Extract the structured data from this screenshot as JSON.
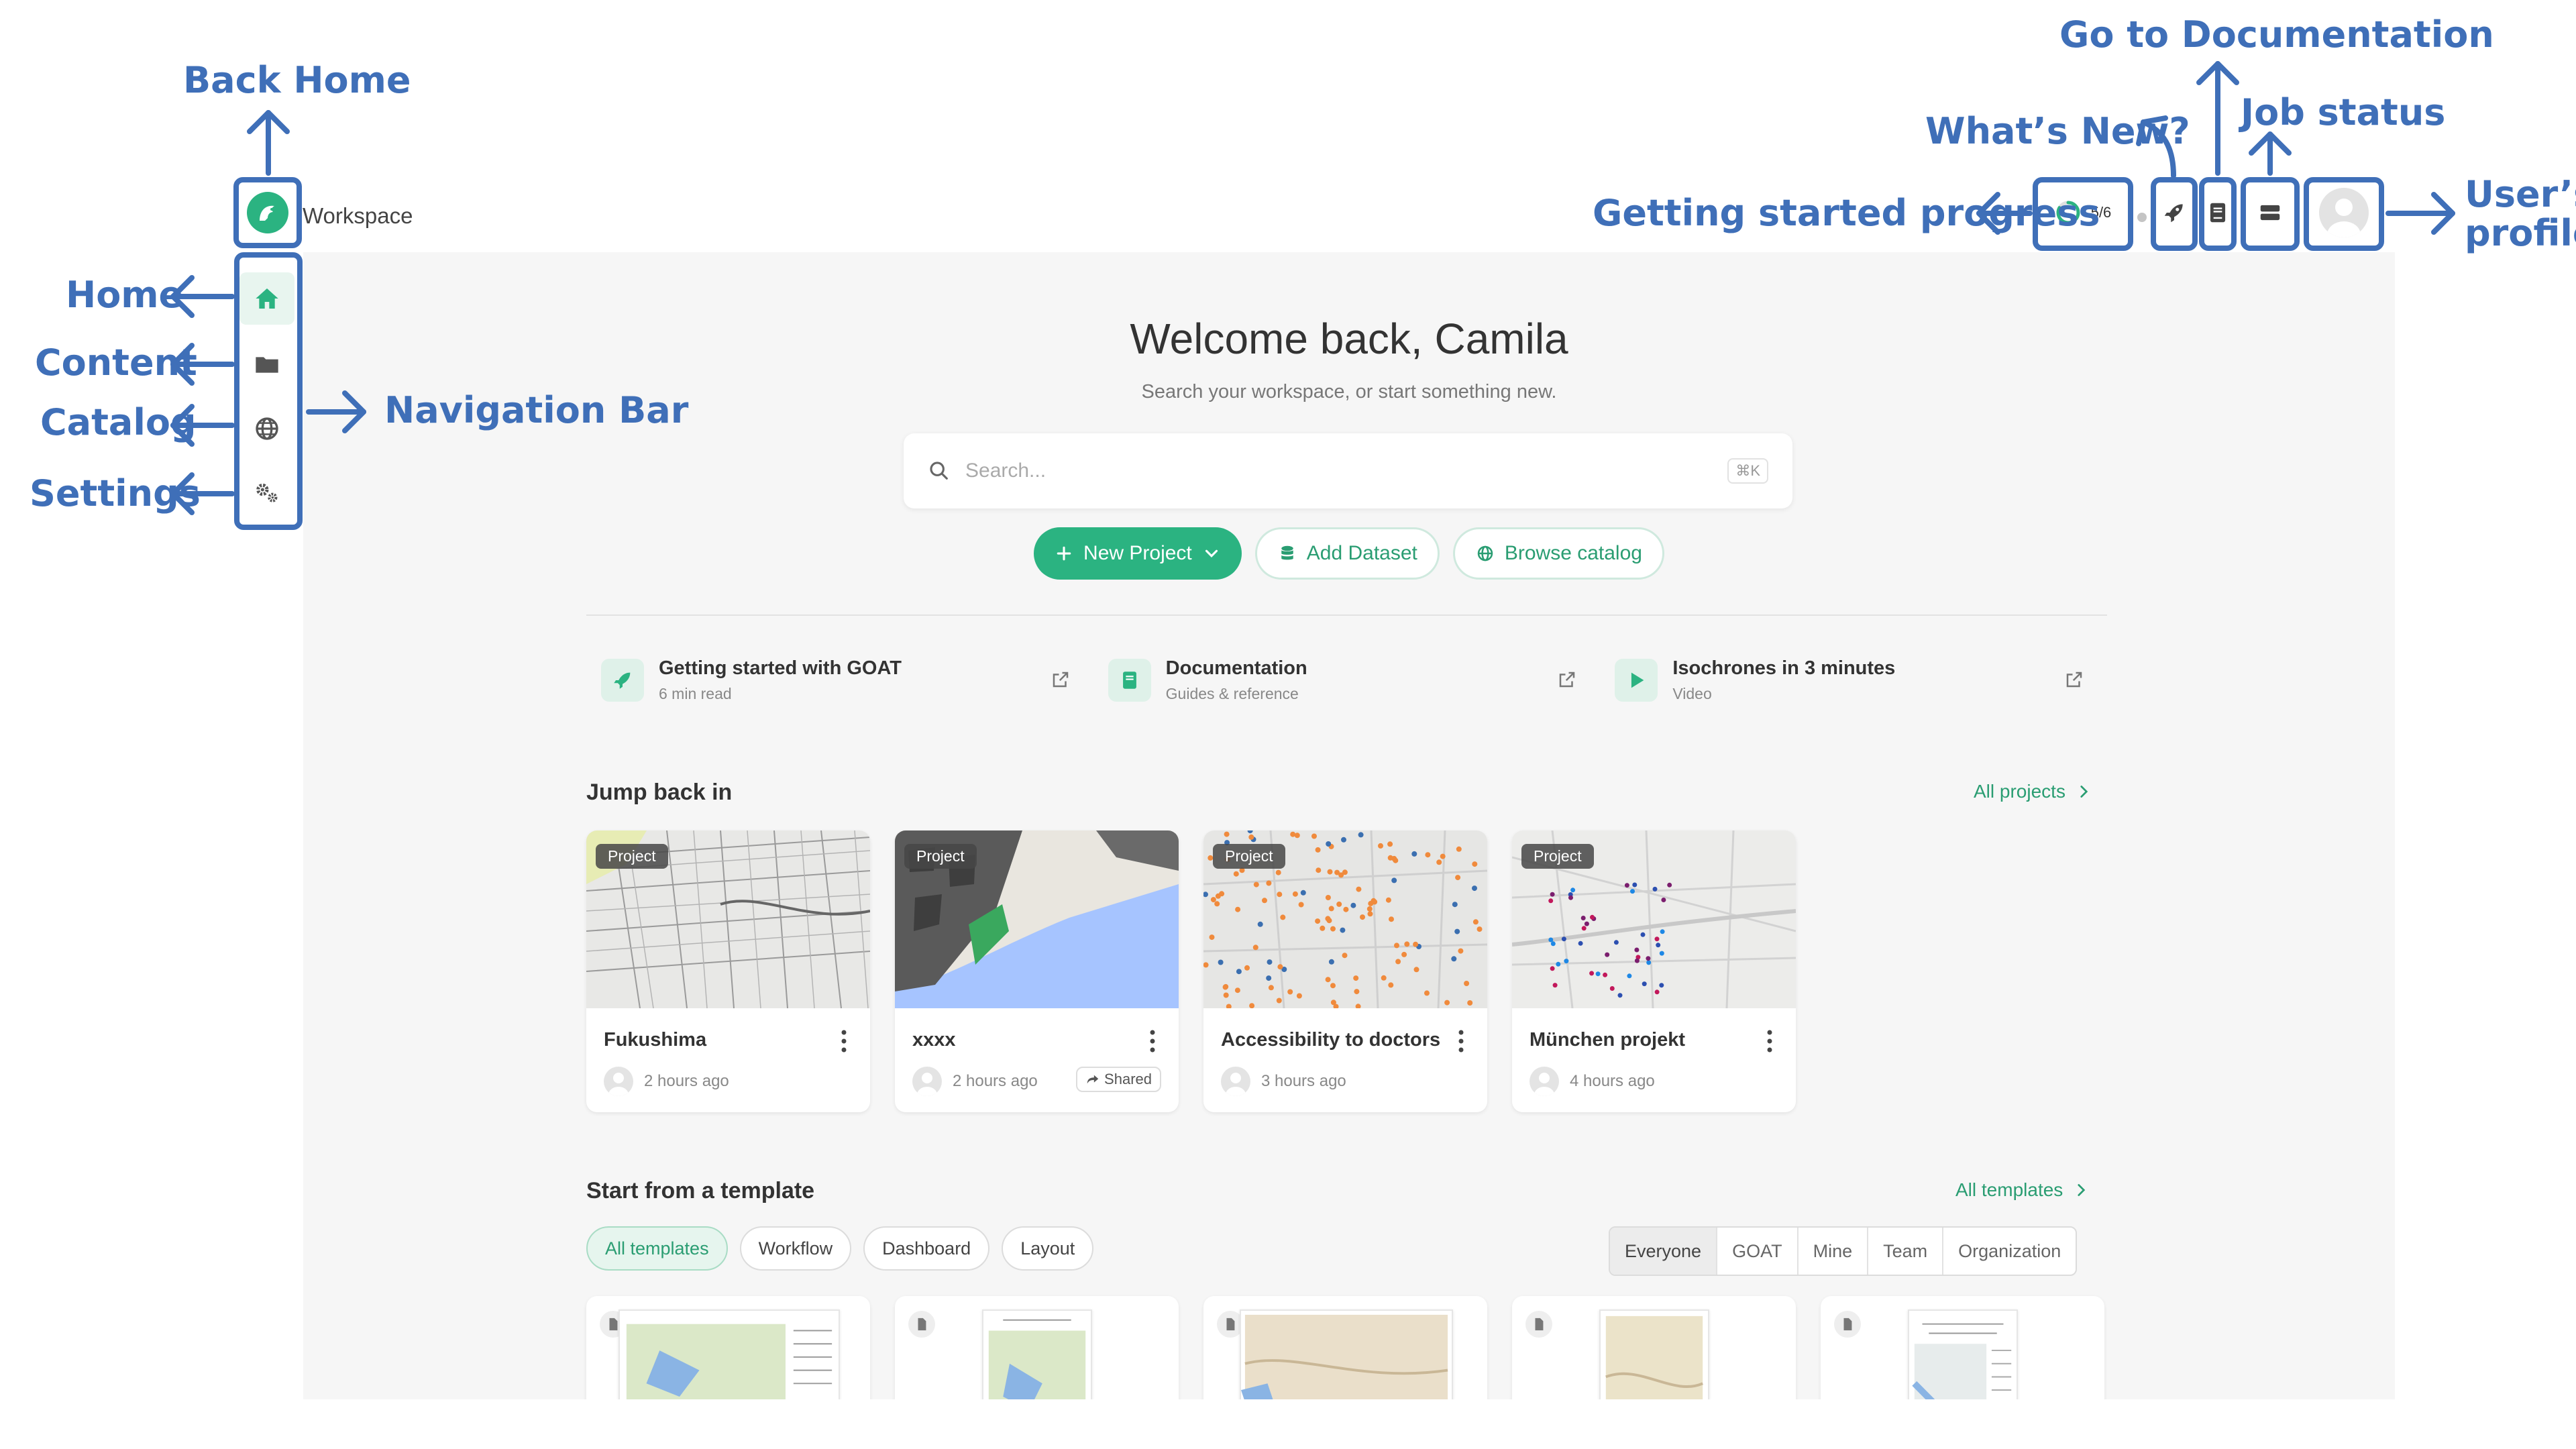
{
  "app": {
    "brand": "Workspace"
  },
  "topbar": {
    "progress": "5/6",
    "progress_fraction": 0.83
  },
  "annotations": {
    "back_home": "Back Home",
    "home": "Home",
    "content": "Content",
    "catalog": "Catalog",
    "settings": "Settings",
    "navigation_bar": "Navigation Bar",
    "getting_started": "Getting started progress",
    "whats_new": "What’s New?",
    "go_to_docs": "Go to Documentation",
    "job_status": "Job status",
    "user_profile_1": "User’s",
    "user_profile_2": "profile"
  },
  "main": {
    "welcome": "Welcome back, Camila",
    "subtitle": "Search your workspace, or start something new.",
    "search_placeholder": "Search...",
    "search_shortcut": "⌘K",
    "buttons": {
      "new_project": "New Project",
      "add_dataset": "Add Dataset",
      "browse_catalog": "Browse catalog"
    },
    "resources": [
      {
        "title": "Getting started with GOAT",
        "sub": "6 min read",
        "icon": "rocket-icon"
      },
      {
        "title": "Documentation",
        "sub": "Guides & reference",
        "icon": "book-icon"
      },
      {
        "title": "Isochrones in 3 minutes",
        "sub": "Video",
        "icon": "play-icon"
      }
    ],
    "jump_back": {
      "title": "Jump back in",
      "link": "All projects",
      "projects": [
        {
          "badge": "Project",
          "title": "Fukushima",
          "time": "2 hours ago"
        },
        {
          "badge": "Project",
          "title": "xxxx",
          "time": "2 hours ago",
          "shared": "Shared"
        },
        {
          "badge": "Project",
          "title": "Accessibility to doctors",
          "time": "3 hours ago"
        },
        {
          "badge": "Project",
          "title": "München projekt",
          "time": "4 hours ago"
        }
      ]
    },
    "templates": {
      "title": "Start from a template",
      "link": "All templates",
      "filters": [
        "All templates",
        "Workflow",
        "Dashboard",
        "Layout"
      ],
      "scope": [
        "Everyone",
        "GOAT",
        "Mine",
        "Team",
        "Organization"
      ]
    }
  },
  "colors": {
    "brand": "#2bb381",
    "annotation": "#3f6fb8"
  }
}
